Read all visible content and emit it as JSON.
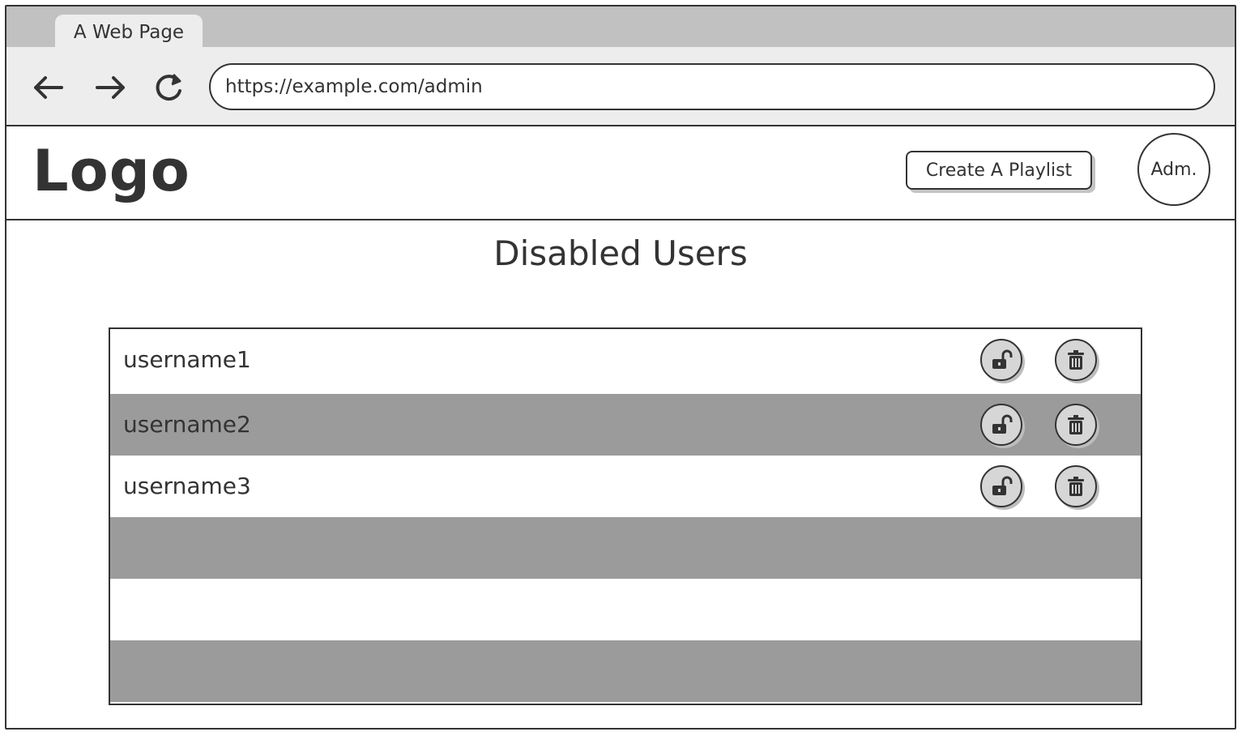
{
  "browser": {
    "tab_title": "A Web Page",
    "url": "https://example.com/admin"
  },
  "header": {
    "logo_text": "Logo",
    "create_playlist_label": "Create A Playlist",
    "avatar_label": "Adm."
  },
  "page": {
    "title": "Disabled Users"
  },
  "users": [
    {
      "username": "username1"
    },
    {
      "username": "username2"
    },
    {
      "username": "username3"
    },
    {
      "username": ""
    },
    {
      "username": ""
    },
    {
      "username": ""
    }
  ],
  "icons": {
    "back": "arrow-left",
    "forward": "arrow-right",
    "reload": "reload",
    "unlock": "unlock",
    "trash": "trash"
  },
  "colors": {
    "ink": "#333333",
    "tab_strip": "#c1c1c1",
    "toolbar": "#ededed",
    "alt_row": "#9b9b9b",
    "icon_fill": "#d6d6d6"
  }
}
